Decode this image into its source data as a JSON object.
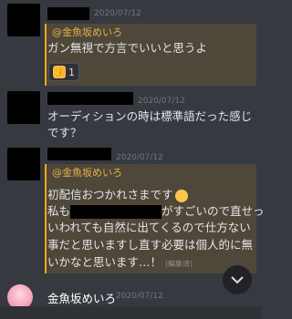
{
  "messages": [
    {
      "timestamp": "2020/07/12",
      "mention": "@金魚坂めいろ",
      "text": "ガン無視で方言でいいと思うよ",
      "reaction": {
        "emoji": "thumbs-up-emoji",
        "count": "1"
      }
    },
    {
      "timestamp": "2020/07/12",
      "lines": [
        "オーディションの時は標準語だった感じ",
        "です？"
      ]
    },
    {
      "timestamp": "2020/07/12",
      "mention": "@金魚坂めいろ",
      "line1": "初配信おつかれさまです",
      "line2_pre": "私も",
      "line2_post": "がすごいので直せっ",
      "line3": "いわれても自然に出てくるので仕方ない",
      "line4": "事だと思いますし直す必要は個人的に無",
      "line5": "いかなと思います…！",
      "edited": "(編集済)"
    }
  ],
  "bottom": {
    "username": "金魚坂めいろ",
    "timestamp": "2020/07/12"
  },
  "colors": {
    "background": "#36393f",
    "mention": "#e3b04b",
    "mention_border": "#faa81a"
  }
}
